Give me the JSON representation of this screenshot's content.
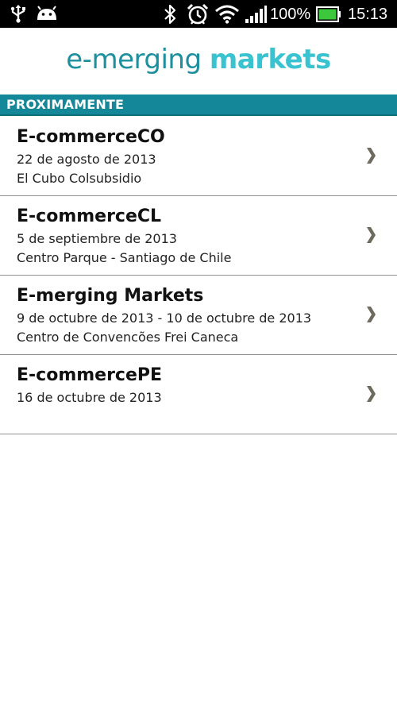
{
  "status_bar": {
    "battery_percent": "100%",
    "time": "15:13",
    "icons": [
      "usb-icon",
      "android-icon",
      "bluetooth-icon",
      "alarm-icon",
      "wifi-icon",
      "signal-icon",
      "battery-icon"
    ],
    "battery_color": "#3cc73c"
  },
  "logo": {
    "part1": "e-merging",
    "part2": "markets",
    "color1": "#1d8f9f",
    "color2": "#39c2cf"
  },
  "section": {
    "title": "PROXIMAMENTE",
    "color": "#148799"
  },
  "events": [
    {
      "title": "E-commerceCO",
      "date": "22 de agosto de 2013",
      "venue": "El Cubo Colsubsidio"
    },
    {
      "title": "E-commerceCL",
      "date": "5 de septiembre de 2013",
      "venue": "Centro Parque - Santiago de Chile"
    },
    {
      "title": "E-merging Markets",
      "date": "9 de octubre de 2013 - 10 de octubre de 2013",
      "venue": "Centro de Convencões Frei Caneca"
    },
    {
      "title": "E-commercePE",
      "date": "16 de octubre de 2013",
      "venue": ""
    }
  ]
}
